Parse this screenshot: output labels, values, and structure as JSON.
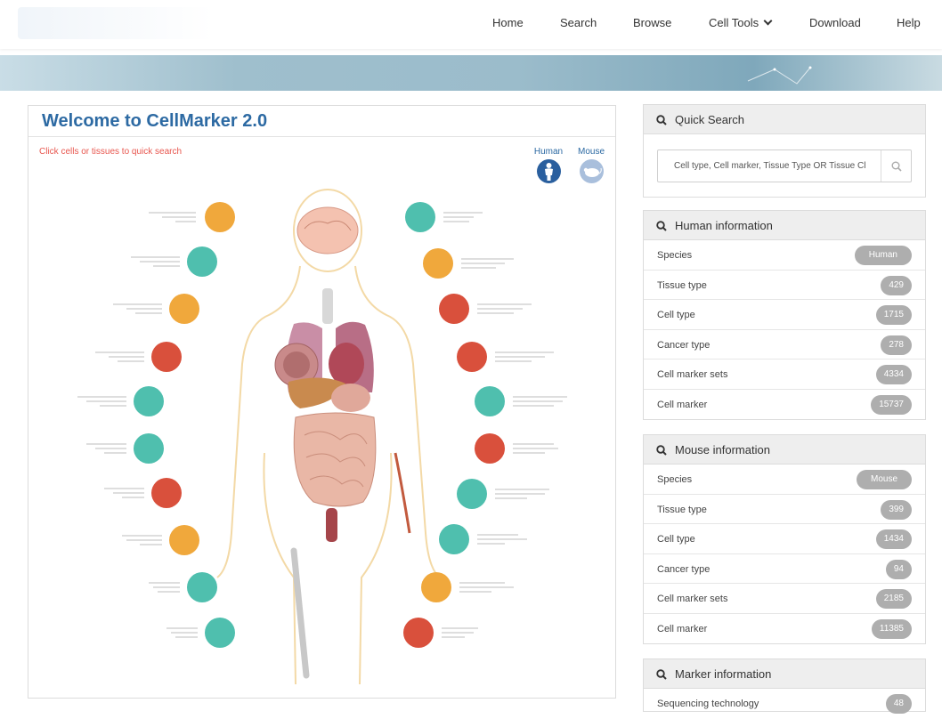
{
  "nav": {
    "items": [
      "Home",
      "Search",
      "Browse",
      "Cell Tools",
      "Download",
      "Help"
    ]
  },
  "welcome": {
    "title": "Welcome to CellMarker 2.0",
    "hint": "Click cells or tissues to quick search",
    "species_human": "Human",
    "species_mouse": "Mouse"
  },
  "quick_search": {
    "title": "Quick Search",
    "placeholder": "Cell type, Cell marker, Tissue Type OR Tissue Cl"
  },
  "human_info": {
    "title": "Human information",
    "rows": [
      {
        "label": "Species",
        "value": "Human"
      },
      {
        "label": "Tissue type",
        "value": "429"
      },
      {
        "label": "Cell type",
        "value": "1715"
      },
      {
        "label": "Cancer type",
        "value": "278"
      },
      {
        "label": "Cell marker sets",
        "value": "4334"
      },
      {
        "label": "Cell marker",
        "value": "15737"
      }
    ]
  },
  "mouse_info": {
    "title": "Mouse information",
    "rows": [
      {
        "label": "Species",
        "value": "Mouse"
      },
      {
        "label": "Tissue type",
        "value": "399"
      },
      {
        "label": "Cell type",
        "value": "1434"
      },
      {
        "label": "Cancer type",
        "value": "94"
      },
      {
        "label": "Cell marker sets",
        "value": "2185"
      },
      {
        "label": "Cell marker",
        "value": "11385"
      }
    ]
  },
  "marker_info": {
    "title": "Marker information",
    "rows": [
      {
        "label": "Sequencing technology",
        "value": "48"
      }
    ]
  },
  "colors": {
    "title_blue": "#2d6aa3",
    "hint_red": "#e8574f",
    "tissue_orange": "#f0a83c",
    "tissue_teal": "#4fbfae",
    "tissue_red": "#d9503c",
    "pill_gray": "#aeaeae",
    "species_blue": "#2a5f9e"
  },
  "icons": [
    "search-icon",
    "chevron-down-icon",
    "human-silhouette-icon",
    "mouse-icon"
  ]
}
